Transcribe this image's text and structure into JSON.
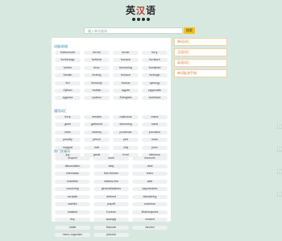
{
  "logo": {
    "left_char": "英",
    "mid_char": "汉",
    "right_char": "语"
  },
  "search": {
    "placeholder": "输入单词查询",
    "button_label": "搜索"
  },
  "sections": [
    {
      "title": "词缀/前缀",
      "words": [
        "furthermore",
        "furred",
        "furrier",
        "furry",
        "furtherings",
        "furthest",
        "furnace",
        "furniture",
        "further",
        "furor",
        "furnishing",
        "furnished",
        "furnish",
        "furlong",
        "furnace",
        "furlough",
        "furl",
        "furiously",
        "furious",
        "synurgy",
        "Zython",
        "furbish",
        "zygote",
        "zygomatic",
        "zygoma",
        "zydeco",
        "Zwinglian",
        "zwieback"
      ]
    },
    {
      "title": "通用词汇",
      "words": [
        "furry",
        "remake",
        "malicious",
        "mane",
        "geek",
        "gathered",
        "skimming",
        "robot",
        "robin",
        "robbery",
        "prudence",
        "provision",
        "penalty",
        "pencil",
        "pelt",
        "main",
        "magical",
        "mat",
        "July",
        "juice",
        "jug",
        "great",
        "front",
        "fabulous"
      ]
    },
    {
      "title": "热门关键词",
      "wide_words": [
        "inspect",
        "cruel",
        "muezzin",
        "dissociation",
        "stay",
        "deal",
        "chemicals",
        "free-thinker",
        "trans",
        "indelible",
        "clothes-line",
        "kale",
        "conniving",
        "generalisations",
        "psychedelic",
        "scraptic",
        "defined",
        "blondering",
        "warlike",
        "payoff",
        "solecism",
        "masked",
        "Korean",
        "Brahmaputra",
        "tiny",
        "spangly",
        "cooked",
        "riddle",
        "Hannah",
        "fanned",
        "micro-organism",
        "pictonic"
      ]
    }
  ],
  "sidebar": [
    "单词词汇",
    "汉语词汇",
    "英语词汇",
    "单词批改手册"
  ],
  "arrows": [
    "^",
    "^",
    "^",
    "^"
  ]
}
